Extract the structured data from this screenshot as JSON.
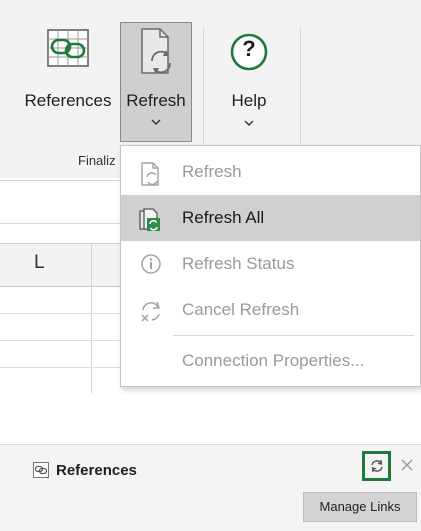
{
  "ribbon": {
    "buttons": {
      "references": {
        "label": "References",
        "icon": "references-icon"
      },
      "refresh": {
        "label": "Refresh",
        "icon": "refresh-icon"
      },
      "help": {
        "label": "Help",
        "icon": "help-icon",
        "glyph": "?"
      }
    },
    "group_label": "Finaliz"
  },
  "sheet": {
    "column_header": "L"
  },
  "refresh_menu": {
    "items": [
      {
        "label": "Refresh",
        "state": "disabled",
        "icon": "refresh-page-icon"
      },
      {
        "label": "Refresh All",
        "state": "active",
        "icon": "refresh-all-icon"
      },
      {
        "label": "Refresh Status",
        "state": "disabled",
        "icon": "info-icon"
      },
      {
        "label": "Cancel Refresh",
        "state": "disabled",
        "icon": "cancel-refresh-icon"
      },
      {
        "label": "Connection Properties...",
        "state": "disabled"
      }
    ]
  },
  "references_pane": {
    "title": "References",
    "icon": "references-icon",
    "refresh_icon": "refresh-icon",
    "close_icon": "close-icon",
    "tooltip": "Manage Links"
  },
  "colors": {
    "highlight_border": "#1d7a3a",
    "menu_active_bg": "#d0d0d0",
    "disabled_text": "#9a9a9a"
  }
}
